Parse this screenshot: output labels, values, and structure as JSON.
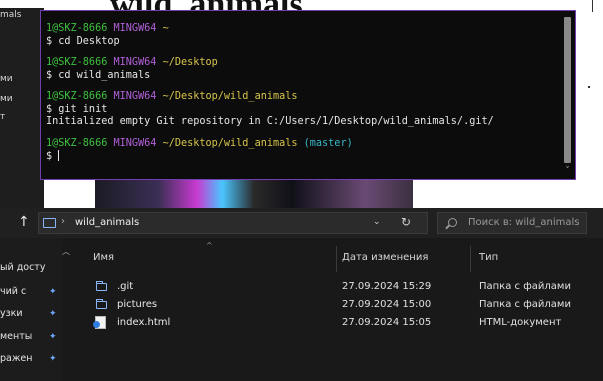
{
  "document": {
    "heading": "wild_animals"
  },
  "background_sidebar": {
    "items": [
      "mals",
      "ми",
      "ми",
      "т"
    ]
  },
  "terminal": {
    "lines": [
      {
        "kind": "prompt",
        "user": "1@SKZ-8666",
        "msys": "MINGW64",
        "path": "~",
        "branch": ""
      },
      {
        "kind": "cmd",
        "text": "$ cd Desktop"
      },
      {
        "kind": "gap"
      },
      {
        "kind": "prompt",
        "user": "1@SKZ-8666",
        "msys": "MINGW64",
        "path": "~/Desktop",
        "branch": ""
      },
      {
        "kind": "cmd",
        "text": "$ cd wild_animals"
      },
      {
        "kind": "gap"
      },
      {
        "kind": "prompt",
        "user": "1@SKZ-8666",
        "msys": "MINGW64",
        "path": "~/Desktop/wild_animals",
        "branch": ""
      },
      {
        "kind": "cmd",
        "text": "$ git init"
      },
      {
        "kind": "cmd",
        "text": "Initialized empty Git repository in C:/Users/1/Desktop/wild_animals/.git/"
      },
      {
        "kind": "gap"
      },
      {
        "kind": "prompt",
        "user": "1@SKZ-8666",
        "msys": "MINGW64",
        "path": "~/Desktop/wild_animals",
        "branch": "(master)"
      },
      {
        "kind": "input",
        "text": "$ "
      }
    ],
    "scroll_arrow": "˅"
  },
  "explorer": {
    "up_arrow": "↑",
    "address": {
      "separator": "›",
      "folder": "wild_animals",
      "dropdown": "⌄",
      "refresh": "↻"
    },
    "search": {
      "placeholder": "Поиск в: wild_animals"
    },
    "nav_items": [
      {
        "label": "ый досту",
        "pinned": false
      },
      {
        "label": "чий с",
        "pinned": true
      },
      {
        "label": "узки",
        "pinned": true
      },
      {
        "label": "менты",
        "pinned": true
      },
      {
        "label": "ражен",
        "pinned": true
      }
    ],
    "columns": {
      "name": "Имя",
      "date": "Дата изменения",
      "type": "Тип",
      "sort_indicator": "^"
    },
    "files": [
      {
        "name": ".git",
        "date": "27.09.2024 15:29",
        "type": "Папка с файлами",
        "icon": "folder-icon"
      },
      {
        "name": "pictures",
        "date": "27.09.2024 15:00",
        "type": "Папка с файлами",
        "icon": "folder-icon"
      },
      {
        "name": "index.html",
        "date": "27.09.2024 15:05",
        "type": "HTML-документ",
        "icon": "html-file-icon"
      }
    ]
  },
  "colors": {
    "terminal_border": "#6f3fb0",
    "prompt_user": "#3ec13e",
    "prompt_msys": "#b160d8",
    "prompt_path": "#d8c54c",
    "prompt_branch": "#38b8c8"
  }
}
